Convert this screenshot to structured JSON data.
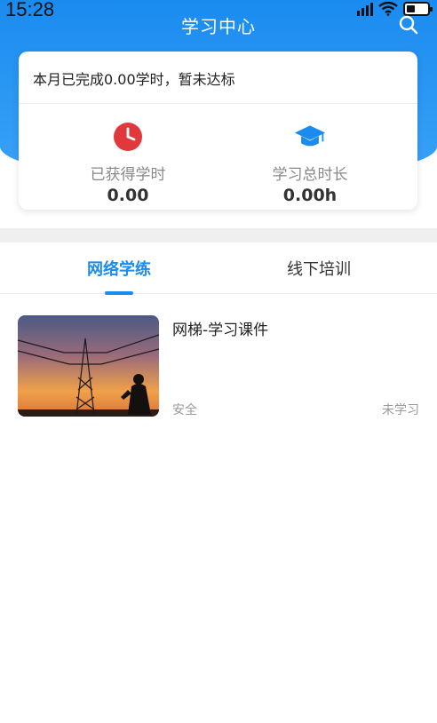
{
  "status_bar": {
    "time": "15:28"
  },
  "header": {
    "title": "学习中心"
  },
  "summary": {
    "status_text": "本月已完成0.00学时，暂未达标",
    "earned_hours_label": "已获得学时",
    "earned_hours_value": "0.00",
    "total_duration_label": "学习总时长",
    "total_duration_value": "0.00h"
  },
  "tabs": [
    {
      "label": "网络学练",
      "active": true
    },
    {
      "label": "线下培训",
      "active": false
    }
  ],
  "courses": [
    {
      "title": "网梯-学习课件",
      "tag": "安全",
      "status": "未学习"
    }
  ],
  "colors": {
    "primary": "#1a8bf0",
    "clock_red": "#e0393b",
    "muted_text": "#999999"
  }
}
